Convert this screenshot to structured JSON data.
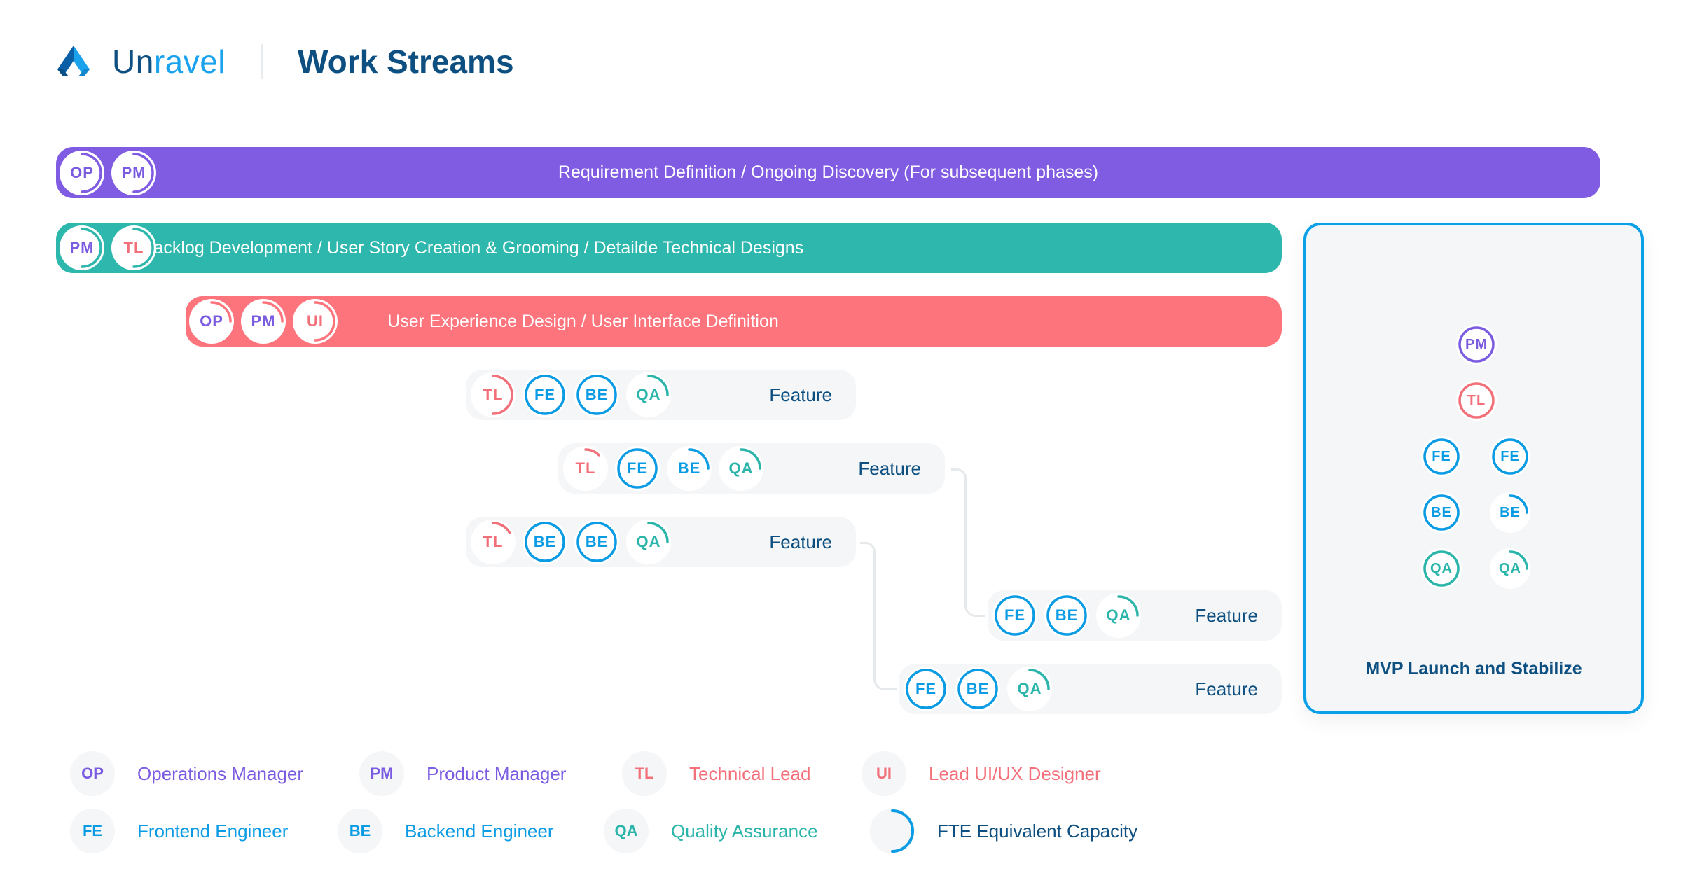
{
  "header": {
    "brand_part1": "Un",
    "brand_part2": "ravel",
    "title": "Work Streams"
  },
  "colors": {
    "OP": "#7b5ce1",
    "PM": "#7b5ce1",
    "TL": "#f2707a",
    "UI": "#f2707a",
    "FE": "#0a9be5",
    "BE": "#0a9be5",
    "QA": "#2bb5aa",
    "purple_bar": "#805ce3",
    "teal_bar": "#2db7ad",
    "pink_bar": "#fe747c",
    "mvp_border": "#0aa0e8",
    "dark_text": "#0d4f80"
  },
  "streams": [
    {
      "label": "Requirement Definition / Ongoing Discovery (For subsequent phases)",
      "color": "#805ce3",
      "roles": [
        {
          "code": "OP",
          "capacity": 0.5
        },
        {
          "code": "PM",
          "capacity": 0.5
        }
      ]
    },
    {
      "label": "Backlog Development / User Story Creation & Grooming / Detailde Technical Designs",
      "color": "#2db7ad",
      "roles": [
        {
          "code": "PM",
          "capacity": 0.5
        },
        {
          "code": "TL",
          "capacity": 0.5
        }
      ]
    },
    {
      "label": "User Experience Design / User Interface Definition",
      "color": "#fe747c",
      "roles": [
        {
          "code": "OP",
          "capacity": 0.25
        },
        {
          "code": "PM",
          "capacity": 0.25
        },
        {
          "code": "UI",
          "capacity": 0.5
        }
      ]
    }
  ],
  "features": [
    {
      "label": "Feature",
      "roles": [
        {
          "code": "TL",
          "capacity": 0.5
        },
        {
          "code": "FE",
          "capacity": 1
        },
        {
          "code": "BE",
          "capacity": 1
        },
        {
          "code": "QA",
          "capacity": 0.25
        }
      ]
    },
    {
      "label": "Feature",
      "roles": [
        {
          "code": "TL",
          "capacity": 0.125
        },
        {
          "code": "FE",
          "capacity": 1
        },
        {
          "code": "BE",
          "capacity": 0.25
        },
        {
          "code": "QA",
          "capacity": 0.25
        }
      ]
    },
    {
      "label": "Feature",
      "roles": [
        {
          "code": "TL",
          "capacity": 0.17
        },
        {
          "code": "BE",
          "capacity": 1
        },
        {
          "code": "BE",
          "capacity": 1
        },
        {
          "code": "QA",
          "capacity": 0.25
        }
      ]
    },
    {
      "label": "Feature",
      "roles": [
        {
          "code": "FE",
          "capacity": 1
        },
        {
          "code": "BE",
          "capacity": 1
        },
        {
          "code": "QA",
          "capacity": 0.25
        }
      ]
    },
    {
      "label": "Feature",
      "roles": [
        {
          "code": "FE",
          "capacity": 1
        },
        {
          "code": "BE",
          "capacity": 1
        },
        {
          "code": "QA",
          "capacity": 0.25
        }
      ]
    }
  ],
  "mvp": {
    "title": "MVP Launch and Stabilize",
    "roles": [
      {
        "code": "PM",
        "capacity": 1
      },
      {
        "code": "TL",
        "capacity": 1
      },
      {
        "code": "FE",
        "capacity": 1
      },
      {
        "code": "FE",
        "capacity": 1
      },
      {
        "code": "BE",
        "capacity": 1
      },
      {
        "code": "BE",
        "capacity": 0.25
      },
      {
        "code": "QA",
        "capacity": 1
      },
      {
        "code": "QA",
        "capacity": 0.25
      }
    ]
  },
  "legend": [
    {
      "code": "OP",
      "label": "Operations Manager"
    },
    {
      "code": "PM",
      "label": "Product Manager"
    },
    {
      "code": "TL",
      "label": "Technical Lead"
    },
    {
      "code": "UI",
      "label": "Lead UI/UX Designer"
    },
    {
      "code": "FE",
      "label": "Frontend Engineer"
    },
    {
      "code": "BE",
      "label": "Backend Engineer"
    },
    {
      "code": "QA",
      "label": "Quality Assurance"
    },
    {
      "code": "",
      "label": "FTE Equivalent Capacity",
      "capacity": 0.5
    }
  ]
}
